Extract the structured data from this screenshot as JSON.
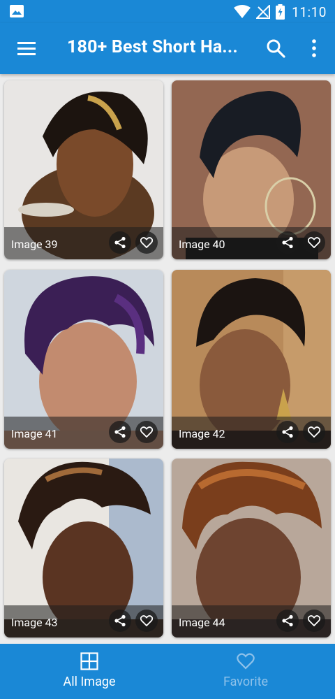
{
  "status_bar": {
    "time": "11:10",
    "icons": [
      "image-notification-icon",
      "wifi-icon",
      "no-signal-icon",
      "battery-charging-icon"
    ]
  },
  "app_bar": {
    "title": "180+ Best Short Ha...",
    "icons": [
      "menu-icon",
      "search-icon",
      "more-vert-icon"
    ]
  },
  "gallery": {
    "items": [
      {
        "caption": "Image 39"
      },
      {
        "caption": "Image 40"
      },
      {
        "caption": "Image 41"
      },
      {
        "caption": "Image 42"
      },
      {
        "caption": "Image 43"
      },
      {
        "caption": "Image 44"
      }
    ]
  },
  "bottom_nav": {
    "items": [
      {
        "label": "All Image",
        "icon": "grid-icon",
        "active": true
      },
      {
        "label": "Favorite",
        "icon": "heart-outline-icon",
        "active": false
      }
    ]
  },
  "colors": {
    "primary": "#1a88d6",
    "inactive_nav": "#8fc2ea",
    "background": "#ececec"
  }
}
